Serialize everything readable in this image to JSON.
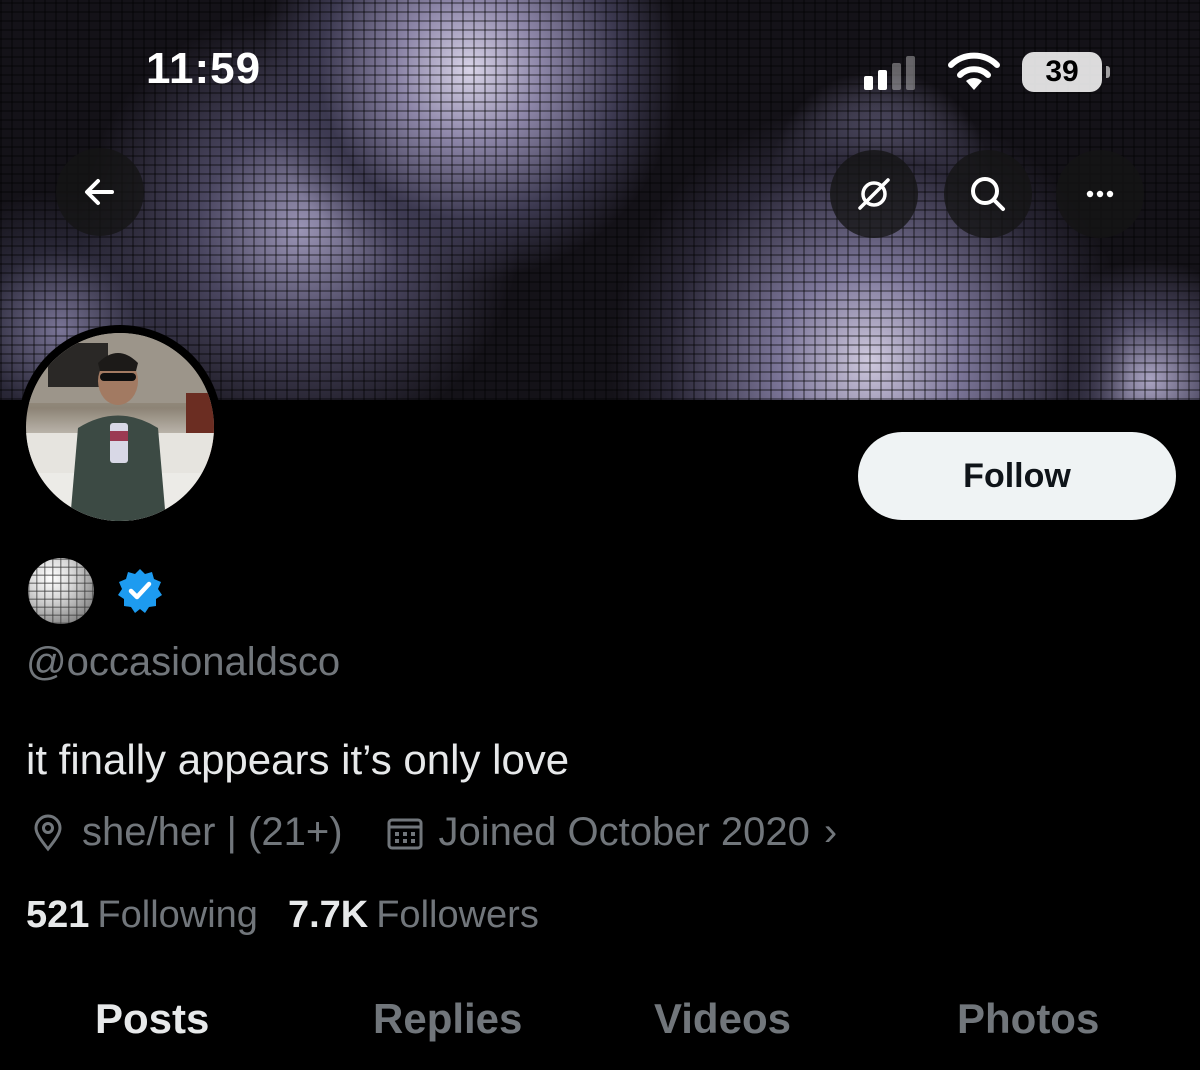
{
  "status_bar": {
    "time": "11:59",
    "battery": "39"
  },
  "nav": {
    "back_icon": "arrow-left-icon",
    "grok_icon": "grok-icon",
    "search_icon": "search-icon",
    "more_icon": "more-icon"
  },
  "profile": {
    "handle": "@occasionaldsco",
    "bio": "it finally appears it’s only love",
    "location": "she/her | (21+)",
    "joined": "Joined October 2020",
    "following_count": "521",
    "following_label": "Following",
    "followers_count": "7.7K",
    "followers_label": "Followers",
    "verified_color": "#1d9bf0"
  },
  "actions": {
    "follow_label": "Follow"
  },
  "tabs": [
    {
      "label": "Posts",
      "active": true
    },
    {
      "label": "Replies",
      "active": false
    },
    {
      "label": "Videos",
      "active": false
    },
    {
      "label": "Photos",
      "active": false
    }
  ]
}
